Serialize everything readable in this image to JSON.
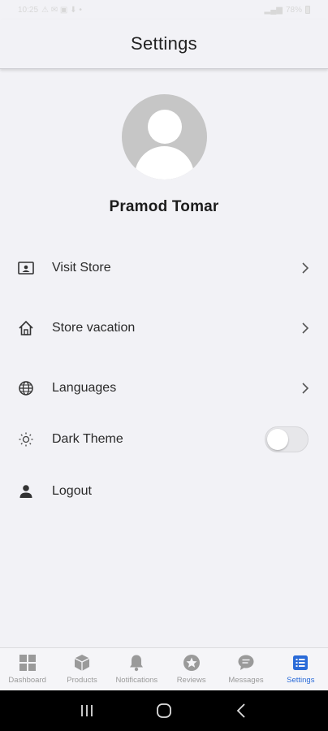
{
  "status_bar": {
    "time": "10:25",
    "battery": "78%"
  },
  "app_bar": {
    "title": "Settings"
  },
  "profile": {
    "name": "Pramod Tomar"
  },
  "menu": [
    {
      "label": "Visit Store",
      "icon": "store-card-icon",
      "chevron": true
    },
    {
      "label": "Store vacation",
      "icon": "home-icon",
      "chevron": true
    },
    {
      "label": "Languages",
      "icon": "globe-icon",
      "chevron": true
    },
    {
      "label": "Dark Theme",
      "icon": "sun-icon",
      "toggle": false
    },
    {
      "label": "Logout",
      "icon": "person-icon"
    }
  ],
  "bottom_nav": [
    {
      "label": "Dashboard",
      "icon": "grid-icon",
      "active": false
    },
    {
      "label": "Products",
      "icon": "box-icon",
      "active": false
    },
    {
      "label": "Notifications",
      "icon": "bell-icon",
      "active": false
    },
    {
      "label": "Reviews",
      "icon": "star-circle-icon",
      "active": false
    },
    {
      "label": "Messages",
      "icon": "chat-icon",
      "active": false
    },
    {
      "label": "Settings",
      "icon": "list-icon",
      "active": true
    }
  ],
  "colors": {
    "background": "#f2f2f6",
    "accent": "#2a6bd8",
    "inactive": "#9a9a9a"
  }
}
